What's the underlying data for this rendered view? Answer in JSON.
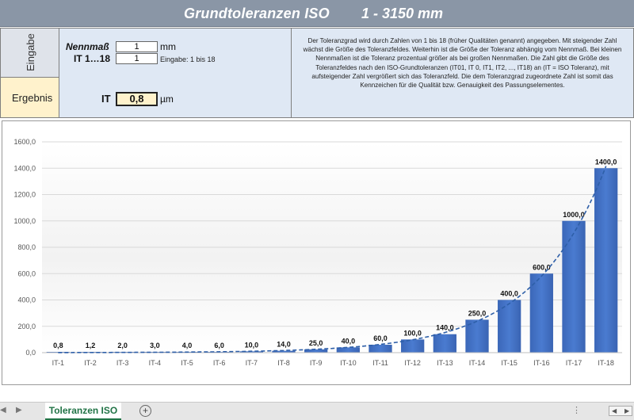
{
  "banner": {
    "title": "Grundtoleranzen ISO",
    "range": "1 - 3150 mm"
  },
  "panel": {
    "eingabe_label": "Eingabe",
    "ergebnis_label": "Ergebnis",
    "nennmass_label": "Nennmaß",
    "nennmass_value": "1",
    "nennmass_unit": "mm",
    "it_label": "IT 1…18",
    "it_value": "1",
    "it_hint": "Eingabe: 1 bis 18",
    "result_label": "IT",
    "result_value": "0,8",
    "result_unit": "µm",
    "description": "Der Toleranzgrad wird durch Zahlen von 1 bis 18 (früher Qualitäten genannt) angegeben. Mit steigender Zahl wächst die Größe des Toleranzfeldes. Weiterhin ist die Größe der Toleranz abhängig vom Nennmaß. Bei kleinen Nennmaßen ist die Toleranz prozentual größer als bei großen Nennmaßen. Die Zahl gibt die Größe des Toleranzfeldes nach den ISO-Grundtoleranzen (IT01, IT 0, IT1, IT2, ..., IT18) an (IT = ISO Toleranz), mit aufsteigender Zahl vergrößert sich das Toleranzfeld. Die dem Toleranzgrad zugeordnete Zahl ist somit das Kennzeichen für die Qualität bzw. Genauigkeit des Passungselementes."
  },
  "chart_data": {
    "type": "bar",
    "categories": [
      "IT-1",
      "IT-2",
      "IT-3",
      "IT-4",
      "IT-5",
      "IT-6",
      "IT-7",
      "IT-8",
      "IT-9",
      "IT-10",
      "IT-11",
      "IT-12",
      "IT-13",
      "IT-14",
      "IT-15",
      "IT-16",
      "IT-17",
      "IT-18"
    ],
    "values": [
      0.8,
      1.2,
      2.0,
      3.0,
      4.0,
      6.0,
      10.0,
      14.0,
      25.0,
      40.0,
      60.0,
      100.0,
      140.0,
      250.0,
      400.0,
      600.0,
      1000.0,
      1400.0
    ],
    "data_labels": [
      "0,8",
      "1,2",
      "2,0",
      "3,0",
      "4,0",
      "6,0",
      "10,0",
      "14,0",
      "25,0",
      "40,0",
      "60,0",
      "100,0",
      "140,0",
      "250,0",
      "400,0",
      "600,0",
      "1000,0",
      "1400,0"
    ],
    "ylim": [
      0,
      1600
    ],
    "yticks": [
      "0,0",
      "200,0",
      "400,0",
      "600,0",
      "800,0",
      "1000,0",
      "1200,0",
      "1400,0",
      "1600,0"
    ],
    "grid": true,
    "trendline": "exponential, dashed",
    "bar_color": "#4472c4",
    "trend_color": "#2e5fa8"
  },
  "tabs": {
    "active": "Toleranzen ISO",
    "add_icon": "plus-circle-icon"
  }
}
